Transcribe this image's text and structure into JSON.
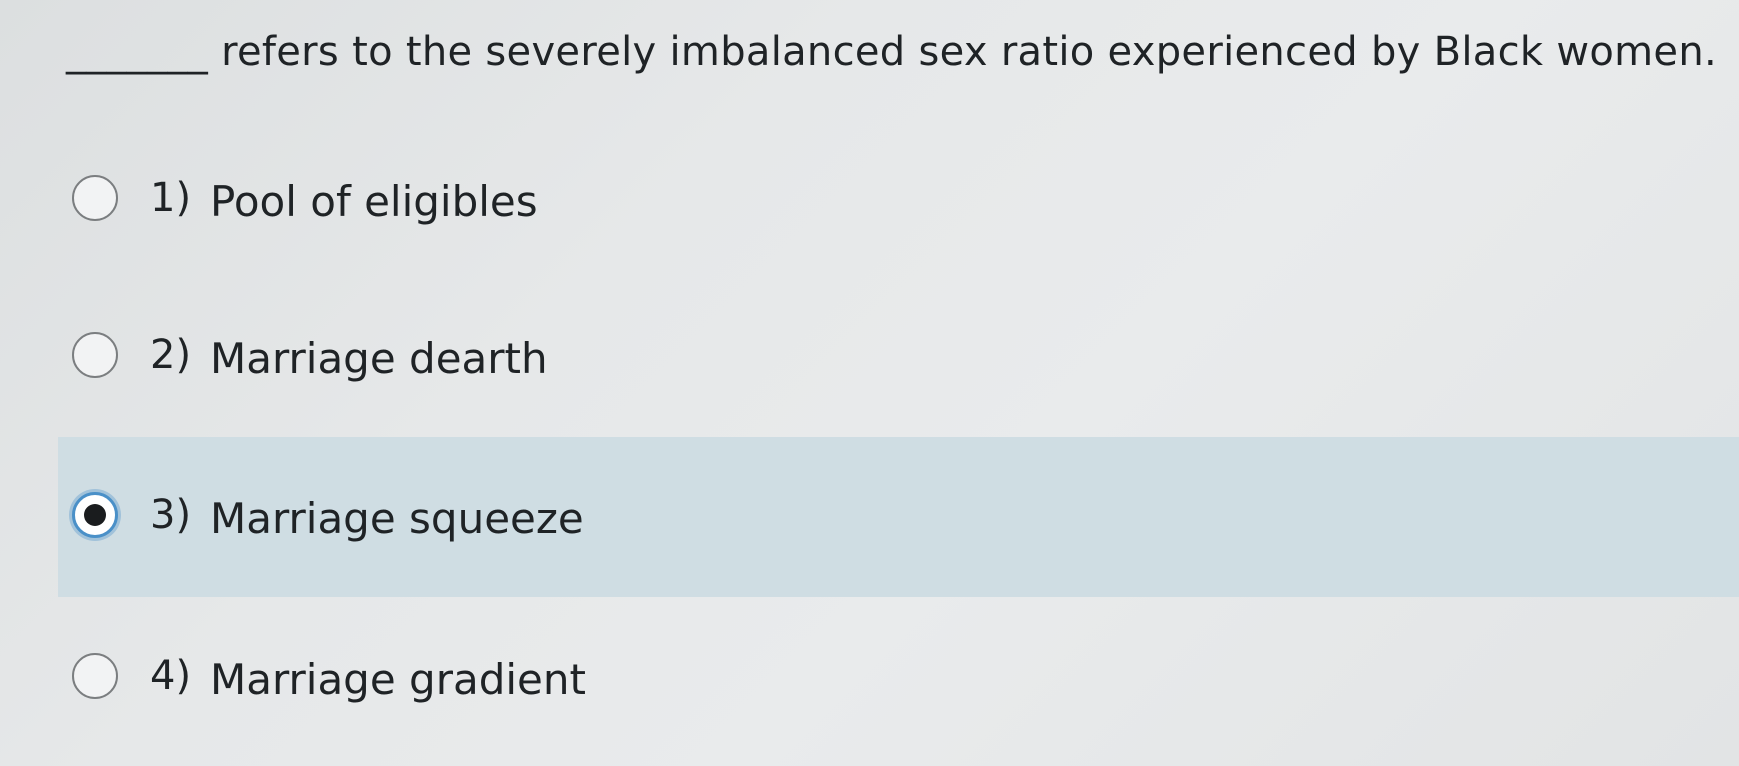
{
  "question": {
    "text": "_______ refers to the severely imbalanced sex ratio experienced by Black women."
  },
  "options": [
    {
      "number": "1)",
      "label": "Pool of eligibles",
      "selected": false
    },
    {
      "number": "2)",
      "label": "Marriage dearth",
      "selected": false
    },
    {
      "number": "3)",
      "label": "Marriage squeeze",
      "selected": true
    },
    {
      "number": "4)",
      "label": "Marriage gradient",
      "selected": false
    }
  ],
  "colors": {
    "selected_background": "#cfdde3",
    "selected_radio_ring": "#4a90c8",
    "text": "#1f2326"
  }
}
